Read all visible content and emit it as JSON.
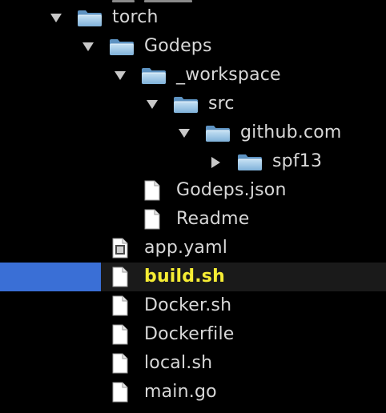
{
  "colors": {
    "background": "#000000",
    "text": "#d8d8d8",
    "selected_text": "#f5ec34",
    "selection_accent": "#3a6fd6",
    "selected_row": "#1a1a1a"
  },
  "tree": {
    "nodes": [
      {
        "label": "torch",
        "type": "folder",
        "state": "expanded",
        "depth": 0,
        "icon": "folder-icon"
      },
      {
        "label": "Godeps",
        "type": "folder",
        "state": "expanded",
        "depth": 1,
        "icon": "folder-icon"
      },
      {
        "label": "_workspace",
        "type": "folder",
        "state": "expanded",
        "depth": 2,
        "icon": "folder-icon"
      },
      {
        "label": "src",
        "type": "folder",
        "state": "expanded",
        "depth": 3,
        "icon": "folder-icon"
      },
      {
        "label": "github.com",
        "type": "folder",
        "state": "expanded",
        "depth": 4,
        "icon": "folder-icon"
      },
      {
        "label": "spf13",
        "type": "folder",
        "state": "collapsed",
        "depth": 5,
        "icon": "folder-icon"
      },
      {
        "label": "Godeps.json",
        "type": "file",
        "depth": 2,
        "icon": "file-icon"
      },
      {
        "label": "Readme",
        "type": "file",
        "depth": 2,
        "icon": "file-icon"
      },
      {
        "label": "app.yaml",
        "type": "file",
        "depth": 1,
        "icon": "config-file-icon"
      },
      {
        "label": "build.sh",
        "type": "file",
        "depth": 1,
        "icon": "file-icon",
        "selected": true
      },
      {
        "label": "Docker.sh",
        "type": "file",
        "depth": 1,
        "icon": "file-icon"
      },
      {
        "label": "Dockerfile",
        "type": "file",
        "depth": 1,
        "icon": "file-icon"
      },
      {
        "label": "local.sh",
        "type": "file",
        "depth": 1,
        "icon": "file-icon"
      },
      {
        "label": "main.go",
        "type": "file",
        "depth": 1,
        "icon": "file-icon"
      }
    ]
  }
}
